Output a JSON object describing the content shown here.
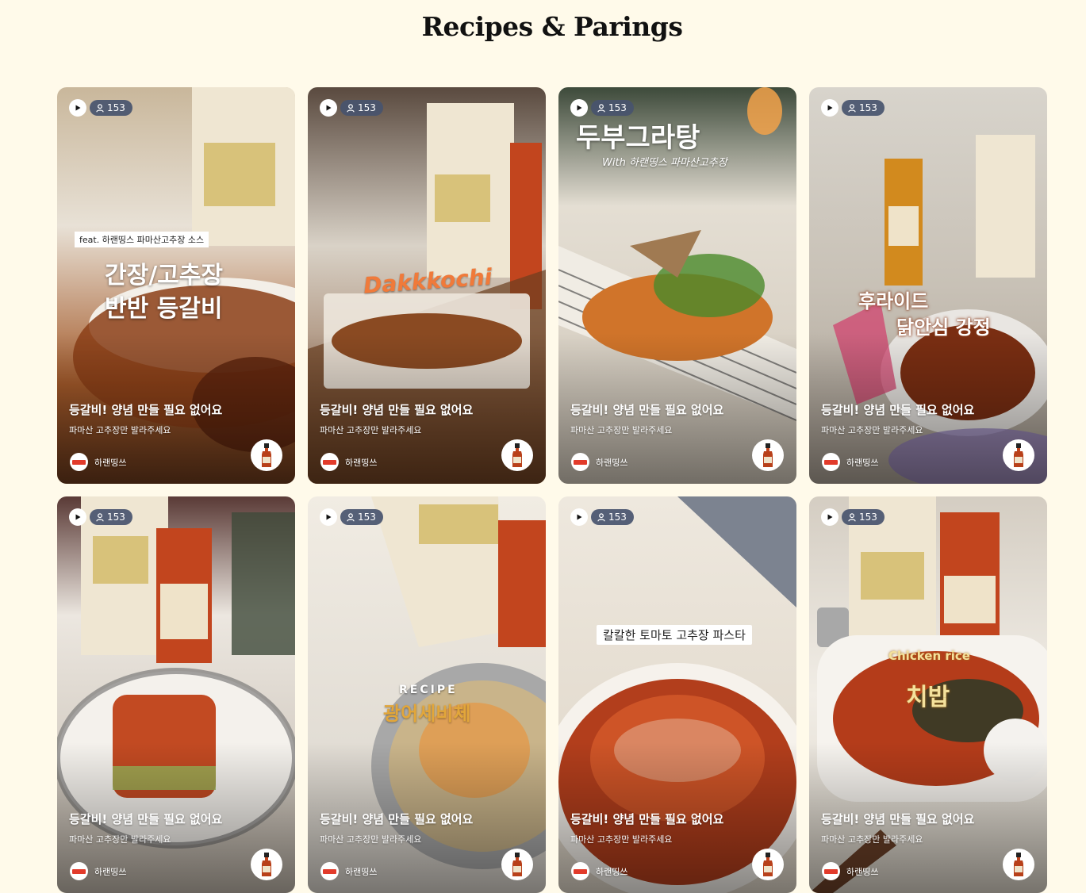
{
  "page": {
    "title": "Recipes & Parings"
  },
  "cards": [
    {
      "viewers": "153",
      "title": "등갈비! 양념 만들 필요 없어요",
      "subtitle": "파마산 고추장만 발라주세요",
      "author": "하랜띵쓰",
      "overlay": [
        "feat. 하랜띵스 파마산고추장 소스",
        "간장/고추장",
        "반반 등갈비"
      ],
      "colors": {
        "top": "#c9b79b",
        "mid": "#e8e1d6",
        "bottom": "#6b3a1c"
      }
    },
    {
      "viewers": "153",
      "title": "등갈비! 양념 만들 필요 없어요",
      "subtitle": "파마산 고추장만 발라주세요",
      "author": "하랜띵쓰",
      "overlay": [
        "Dakkkochi"
      ],
      "colors": {
        "top": "#5a4a3f",
        "mid": "#d9d2c7",
        "bottom": "#7a4a2a"
      }
    },
    {
      "viewers": "153",
      "title": "등갈비! 양념 만들 필요 없어요",
      "subtitle": "파마산 고추장만 발라주세요",
      "author": "하랜띵쓰",
      "overlay": [
        "두부그라탕",
        "With 하랜띵스 파마산고추장"
      ],
      "colors": {
        "top": "#3d4a3a",
        "mid": "#e4ded3",
        "bottom": "#c97b3a"
      }
    },
    {
      "viewers": "153",
      "title": "등갈비! 양념 만들 필요 없어요",
      "subtitle": "파마산 고추장만 발라주세요",
      "author": "하랜띵쓰",
      "overlay": [
        "후라이드",
        "닭안심 강정"
      ],
      "colors": {
        "top": "#d8d4cc",
        "mid": "#c8c1b6",
        "bottom": "#8a3d1e"
      }
    },
    {
      "viewers": "153",
      "title": "등갈비! 양념 만들 필요 없어요",
      "subtitle": "파마산 고추장만 발라주세요",
      "author": "하랜띵쓰",
      "overlay": [],
      "colors": {
        "top": "#5a3a36",
        "mid": "#ece7e0",
        "bottom": "#b3492a"
      }
    },
    {
      "viewers": "153",
      "title": "등갈비! 양념 만들 필요 없어요",
      "subtitle": "파마산 고추장만 발라주세요",
      "author": "하랜띵쓰",
      "overlay": [
        "RECIPE",
        "광어세비체"
      ],
      "colors": {
        "top": "#f1ece3",
        "mid": "#d9d4cc",
        "bottom": "#b88a3a"
      }
    },
    {
      "viewers": "153",
      "title": "등갈비! 양념 만들 필요 없어요",
      "subtitle": "파마산 고추장만 발라주세요",
      "author": "하랜띵쓰",
      "overlay": [
        "칼칼한 토마토 고추장 파스타"
      ],
      "colors": {
        "top": "#7c8390",
        "mid": "#eee8de",
        "bottom": "#a53a1e"
      }
    },
    {
      "viewers": "153",
      "title": "등갈비! 양념 만들 필요 없어요",
      "subtitle": "파마산 고추장만 발라주세요",
      "author": "하랜띵쓰",
      "overlay": [
        "Chicken rice",
        "치밥"
      ],
      "colors": {
        "top": "#d4cdc2",
        "mid": "#f1ede6",
        "bottom": "#9c3a1a"
      }
    }
  ]
}
